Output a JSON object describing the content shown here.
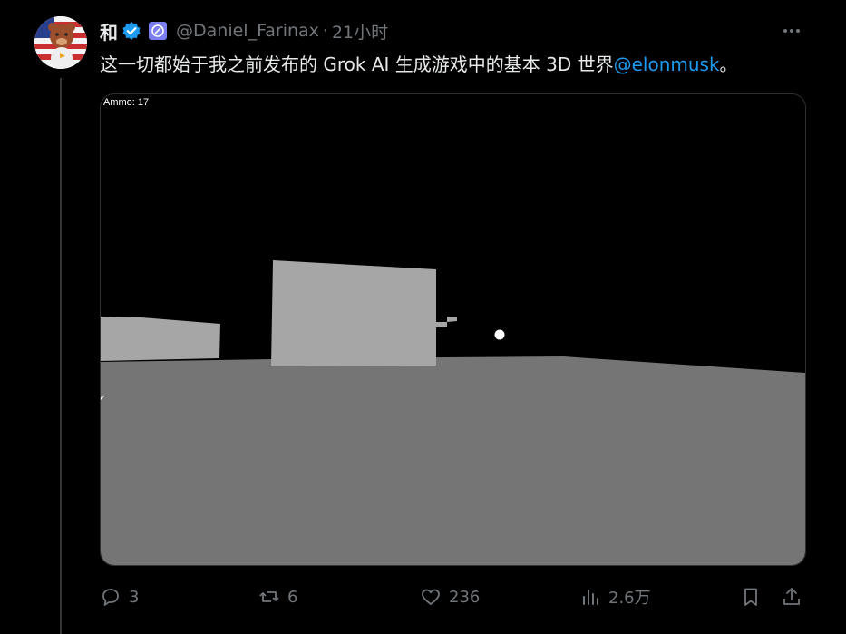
{
  "tweet": {
    "author_name": "和",
    "handle": "@Daniel_Farinax",
    "separator": "·",
    "time": "21小时",
    "text_main": "这一切都始于我之前发布的 Grok AI 生成游戏中的基本 3D 世界",
    "mention": "@elonmusk",
    "text_end": "。"
  },
  "media": {
    "ammo_label": "Ammo: 17",
    "colors": {
      "sky": "#000000",
      "ground": "#757575",
      "block": "#a6a6a6"
    }
  },
  "actions": {
    "replies": "3",
    "reposts": "6",
    "likes": "236",
    "views": "2.6万"
  },
  "colors": {
    "accent": "#1d9bf0",
    "muted": "#71767b",
    "text": "#e7e9ea"
  }
}
